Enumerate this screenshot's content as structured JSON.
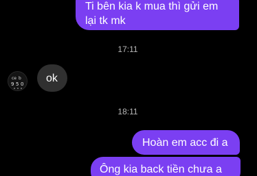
{
  "conversation": {
    "messages": [
      {
        "sender": "me",
        "lines": [
          "Ti bên kia k mua thì gửi em",
          "lại tk mk"
        ]
      },
      {
        "type": "timestamp",
        "text": "17:11"
      },
      {
        "sender": "other",
        "text": "ok"
      },
      {
        "type": "timestamp",
        "text": "18:11"
      },
      {
        "sender": "me",
        "text": "Hoàn em acc đi a"
      },
      {
        "sender": "me",
        "text": "Ông kia back tiền chưa a"
      }
    ]
  },
  "colors": {
    "background": "#000000",
    "outgoing_bubble": "#7b3ff2",
    "incoming_bubble": "#303030",
    "timestamp_text": "#b8b8b8"
  },
  "avatar": {
    "icon": "contact-avatar-icon"
  }
}
